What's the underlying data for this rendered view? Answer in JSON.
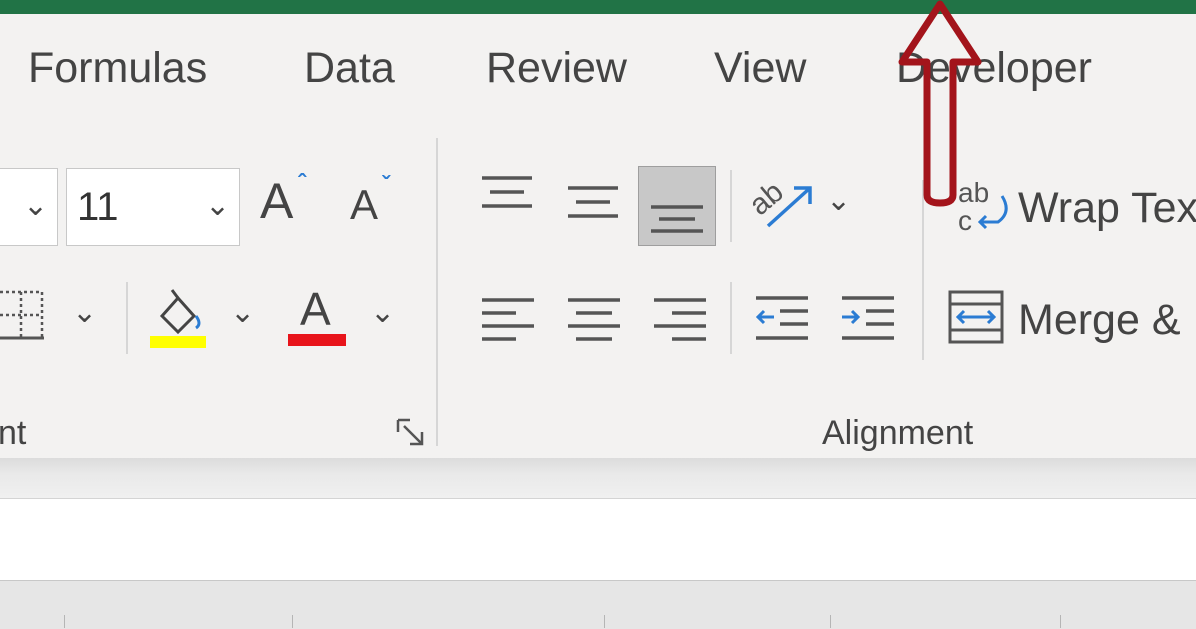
{
  "tabs": [
    "Formulas",
    "Data",
    "Review",
    "View",
    "Developer"
  ],
  "font_group": {
    "font_size_value": "11",
    "label": "nt",
    "increase_font_icon": "A-caret-up",
    "decrease_font_icon": "A-caret-down",
    "highlight_color": "#ffff00",
    "font_color": "#e8141b"
  },
  "alignment_group": {
    "label": "Alignment",
    "wrap_text_label": "Wrap Tex",
    "merge_label": "Merge &",
    "wrap_icon_text": "ab c"
  },
  "colors": {
    "title_bar": "#217346",
    "arrow_annotation": "#a3141b",
    "active_button": "#c8c8c8"
  }
}
